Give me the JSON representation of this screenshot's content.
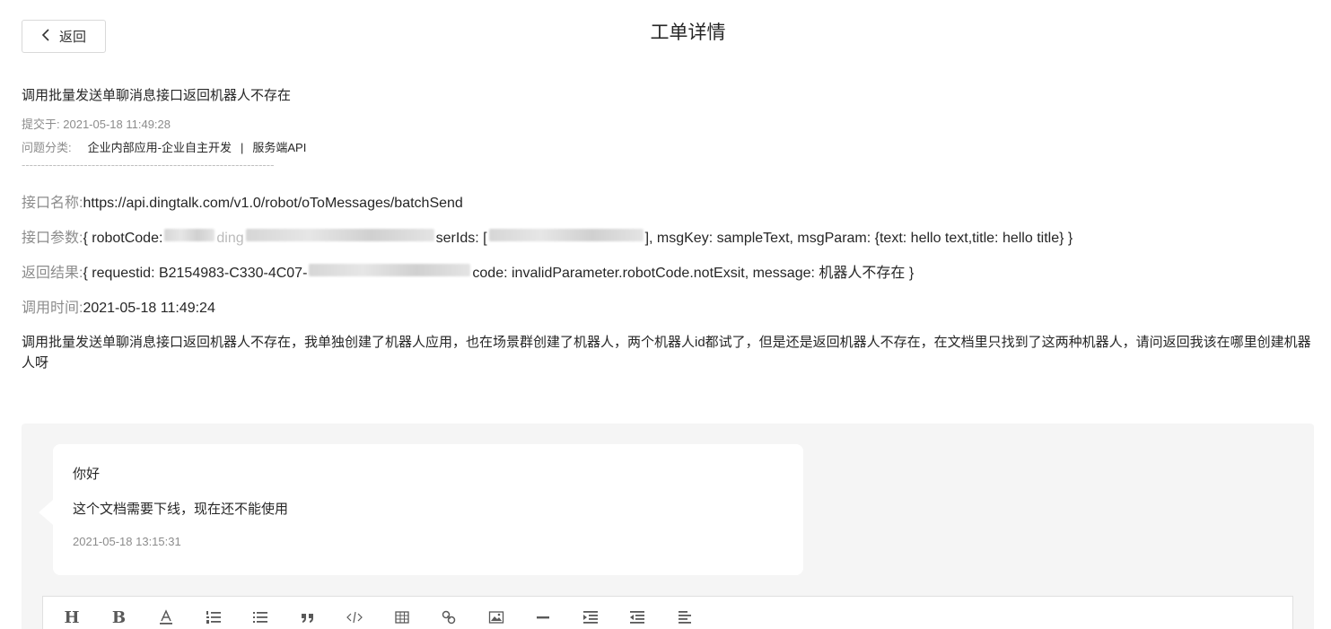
{
  "header": {
    "back_label": "返回",
    "title": "工单详情"
  },
  "ticket": {
    "title": "调用批量发送单聊消息接口返回机器人不存在",
    "submitted_label": "提交于:",
    "submitted_at": "2021-05-18 11:49:28",
    "category_label": "问题分类:",
    "category_primary": "企业内部应用-企业自主开发",
    "category_separator": "|",
    "category_secondary": "服务端API",
    "divider": "-----------------------------------------------------------------"
  },
  "fields": {
    "api_name_label": "接口名称:",
    "api_name": "https://api.dingtalk.com/v1.0/robot/oToMessages/batchSend",
    "params_label": "接口参数:",
    "params_part1": "{ robotCode:",
    "params_part2": "ding",
    "params_part3": "serIds: [",
    "params_part4": "], msgKey: sampleText, msgParam: {text: hello text,title: hello title} }",
    "result_label": "返回结果:",
    "result_part1": "{ requestid: B2154983-C330-4C07-",
    "result_part2": "code: invalidParameter.robotCode.notExsit, message: 机器人不存在 }",
    "time_label": "调用时间:",
    "time_value": "2021-05-18 11:49:24"
  },
  "description": "调用批量发送单聊消息接口返回机器人不存在，我单独创建了机器人应用，也在场景群创建了机器人，两个机器人id都试了，但是还是返回机器人不存在，在文档里只找到了这两种机器人，请问返回我该在哪里创建机器人呀",
  "reply": {
    "line1": "你好",
    "line2": "这个文档需要下线，现在还不能使用",
    "time": "2021-05-18 13:15:31"
  },
  "toolbar": {
    "heading": "H",
    "bold": "B",
    "icons": [
      "heading-icon",
      "bold-icon",
      "text-color-icon",
      "ordered-list-icon",
      "bullet-list-icon",
      "quote-icon",
      "code-icon",
      "table-icon",
      "link-icon",
      "image-icon",
      "horizontal-rule-icon",
      "indent-icon",
      "outdent-icon",
      "align-icon"
    ]
  }
}
